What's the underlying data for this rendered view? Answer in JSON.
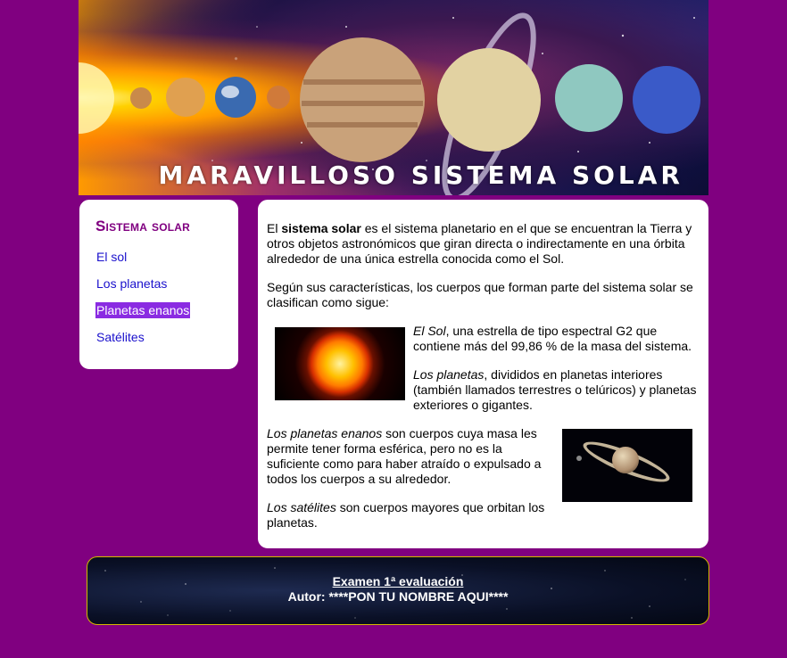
{
  "banner": {
    "title": "MARAVILLOSO SISTEMA SOLAR"
  },
  "sidebar": {
    "title": "Sistema solar",
    "items": [
      {
        "label": "El sol",
        "active": false
      },
      {
        "label": "Los planetas",
        "active": false
      },
      {
        "label": "Planetas enanos",
        "active": true
      },
      {
        "label": "Satélites",
        "active": false
      }
    ]
  },
  "content": {
    "p1": {
      "a": "El ",
      "b": "sistema solar",
      "c": " es el sistema planetario en el que se encuentran la Tierra y otros objetos astronómicos que giran directa o indirectamente en una órbita alrededor de una única estrella conocida como el Sol."
    },
    "p2": "Según sus características, los cuerpos que forman parte del sistema solar se clasifican como sigue:",
    "p3": {
      "em": "El Sol",
      "rest": ", una estrella de tipo espectral G2 que contiene más del 99,86 % de la masa del sistema."
    },
    "p4": {
      "em": "Los planetas",
      "rest": ", divididos en planetas interiores (también llamados terrestres o telúricos) y planetas exteriores o gigantes."
    },
    "p5": {
      "em": "Los planetas enanos",
      "rest": " son cuerpos cuya masa les permite tener forma esférica, pero no es la suficiente como para haber atraído o expulsado a todos los cuerpos a su alrededor."
    },
    "p6": {
      "em": "Los satélites",
      "rest": " son cuerpos mayores que orbitan los planetas."
    }
  },
  "footer": {
    "link": "Examen 1ª evaluación",
    "author": "Autor: ****PON TU NOMBRE AQUI****"
  },
  "colors": {
    "page_background": "#800080",
    "sidebar_title": "#800080",
    "nav_link": "#1a10cc",
    "nav_active_bg": "#8a2be2"
  }
}
